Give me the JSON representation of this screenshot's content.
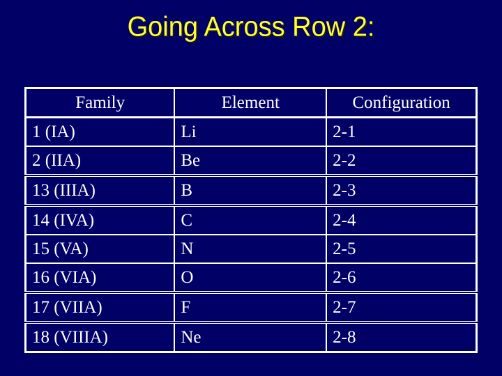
{
  "slide": {
    "title": "Going Across Row 2:",
    "colors": {
      "background": "#000066",
      "title": "#ffff33",
      "text": "#ffffff"
    }
  },
  "table": {
    "headers": [
      "Family",
      "Element",
      "Configuration"
    ],
    "rows": [
      [
        "1 (IA)",
        "Li",
        "2-1"
      ],
      [
        "2 (IIA)",
        "Be",
        "2-2"
      ],
      [
        "13 (IIIA)",
        "B",
        "2-3"
      ],
      [
        "14 (IVA)",
        "C",
        "2-4"
      ],
      [
        "15 (VA)",
        "N",
        "2-5"
      ],
      [
        "16 (VIA)",
        "O",
        "2-6"
      ],
      [
        "17 (VIIA)",
        "F",
        "2-7"
      ],
      [
        "18 (VIIIA)",
        "Ne",
        "2-8"
      ]
    ]
  }
}
